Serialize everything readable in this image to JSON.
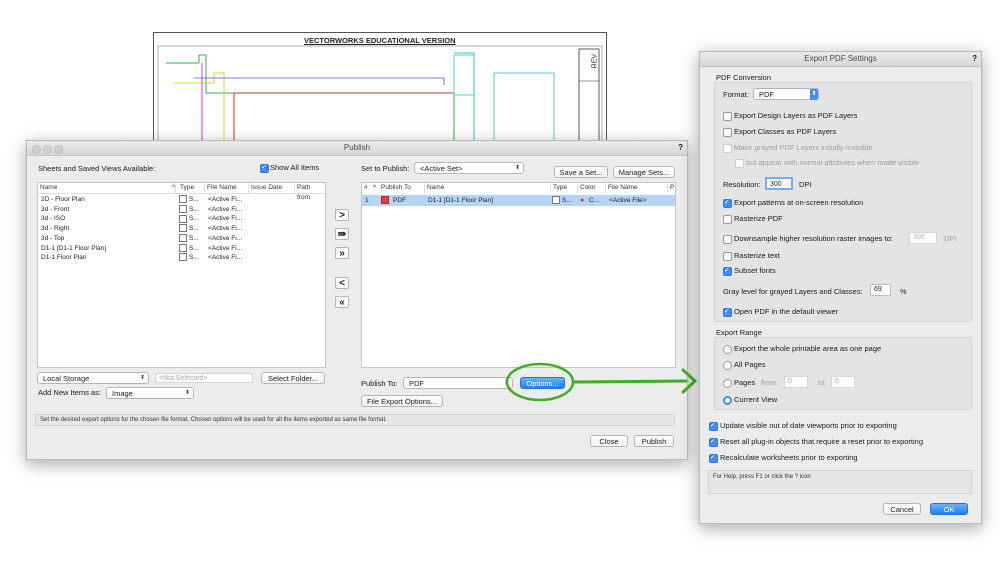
{
  "drawing": {
    "title": "VECTORWORKS EDUCATIONAL VERSION",
    "rev_label": "REV."
  },
  "publish": {
    "title": "Publish",
    "help": "?",
    "available_label": "Sheets and Saved Views Available:",
    "show_all_label": "Show All Items",
    "columns": [
      "Name",
      "Type",
      "File Name",
      "Issue Date",
      "Path from"
    ],
    "sort_indicator": "^",
    "items": [
      {
        "name": "2D - Floor Plan",
        "type": "S...",
        "file": "<Active Fi..."
      },
      {
        "name": "3d - Front",
        "type": "S...",
        "file": "<Active Fi..."
      },
      {
        "name": "3d - ISO",
        "type": "S...",
        "file": "<Active Fi..."
      },
      {
        "name": "3d - Right",
        "type": "S...",
        "file": "<Active Fi..."
      },
      {
        "name": "3d - Top",
        "type": "S...",
        "file": "<Active Fi..."
      },
      {
        "name": "D1-1 [D1-1 Floor Plan]",
        "type": "S...",
        "file": "<Active Fi..."
      },
      {
        "name": "D1-1 Floor Plan",
        "type": "S...",
        "file": "<Active Fi..."
      }
    ],
    "storage": "Local Storage",
    "not_selected": "<Not Selected>",
    "select_folder": "Select Folder...",
    "add_new_label": "Add New Items as:",
    "add_new_value": "Image",
    "set_label": "Set to Publish:",
    "set_value": "<Active Set>",
    "save_set": "Save a Set...",
    "manage_sets": "Manage Sets...",
    "set_columns": [
      "#",
      "^",
      "Publish To",
      "Name",
      "Type",
      "Color",
      "File Name",
      "P"
    ],
    "set_row": {
      "num": "1",
      "publish_to": "PDF",
      "name": "D1-1 [D1-1 Floor Plan]",
      "type": "S...",
      "color": "C...",
      "file": "<Active File>"
    },
    "arrows": [
      ">",
      "⇛",
      "»",
      "<",
      "«"
    ],
    "publish_to_label": "Publish To:",
    "publish_to_value": "PDF",
    "options": "Options...",
    "file_export_options": "File Export Options...",
    "status": "Set the desired export options for the chosen file format. Chosen options will be used for all the items exported as same file format.",
    "close": "Close",
    "publish_btn": "Publish"
  },
  "pdf": {
    "title": "Export PDF Settings",
    "help": "?",
    "section_conversion": "PDF Conversion",
    "format_label": "Format:",
    "format_value": "PDF",
    "export_design_layers": "Export Design Layers as PDF Layers",
    "export_classes": "Export Classes as PDF Layers",
    "make_grayed": "Make grayed PDF Layers initially invisible",
    "but_appear": "but appear with normal attributes when made visible",
    "resolution_label": "Resolution:",
    "resolution_value": "300",
    "dpi": "DPI",
    "export_patterns": "Export patterns at on-screen resolution",
    "rasterize_pdf": "Rasterize PDF",
    "downsample": "Downsample higher resolution raster images to:",
    "downsample_value": "300",
    "downsample_dpi": "DPI",
    "rasterize_text": "Rasterize text",
    "subset_fonts": "Subset fonts",
    "gray_level_label": "Gray level for grayed Layers and Classes:",
    "gray_level_value": "69",
    "percent": "%",
    "open_pdf": "Open PDF in the default viewer",
    "section_range": "Export Range",
    "range_whole": "Export the whole printable area as one page",
    "range_all": "All Pages",
    "range_pages": "Pages",
    "from_label": "from:",
    "from_value": "0",
    "to_label": "to:",
    "to_value": "0",
    "range_current": "Current View",
    "update_viewports": "Update visible out of date viewports prior to exporting",
    "reset_plugins": "Reset all plug-in objects that require a reset prior to exporting",
    "recalc_worksheets": "Recalculate worksheets prior to exporting",
    "help_text": "For Help, press F1 or click the ? icon",
    "cancel": "Cancel",
    "ok": "OK"
  },
  "annotation_color": "#3fae25"
}
